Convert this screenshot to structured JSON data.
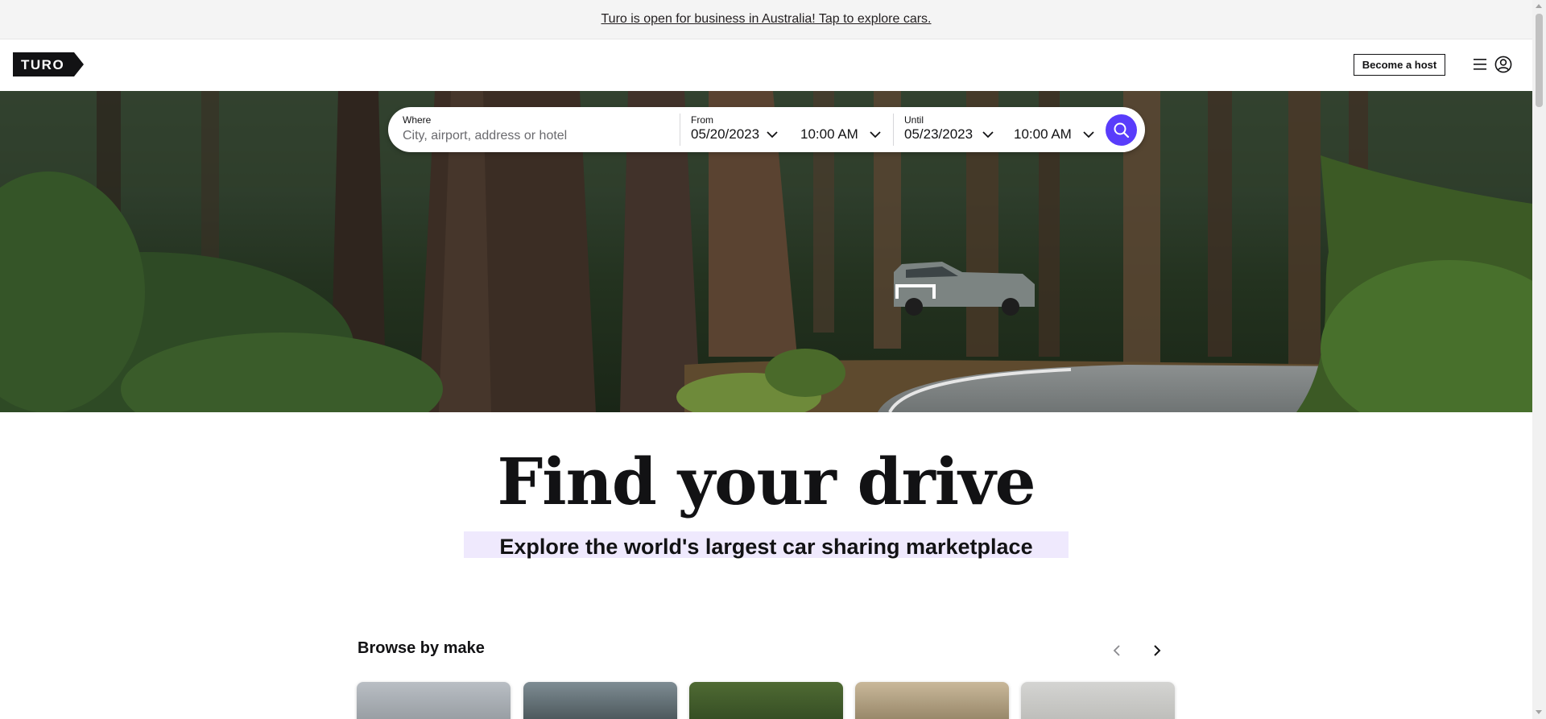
{
  "banner": {
    "text": "Turo is open for business in Australia! Tap to explore cars."
  },
  "header": {
    "logo_text": "TURO",
    "become_host_label": "Become a host"
  },
  "search": {
    "where_label": "Where",
    "where_placeholder": "City, airport, address or hotel",
    "from_label": "From",
    "from_date": "05/20/2023",
    "from_time": "10:00 AM",
    "until_label": "Until",
    "until_date": "05/23/2023",
    "until_time": "10:00 AM"
  },
  "hero": {
    "headline": "Find your drive",
    "subheadline": "Explore the world's largest car sharing marketplace"
  },
  "browse": {
    "title": "Browse by make"
  },
  "colors": {
    "accent": "#593cfb",
    "text": "#121214",
    "highlight": "#efe9fd"
  }
}
